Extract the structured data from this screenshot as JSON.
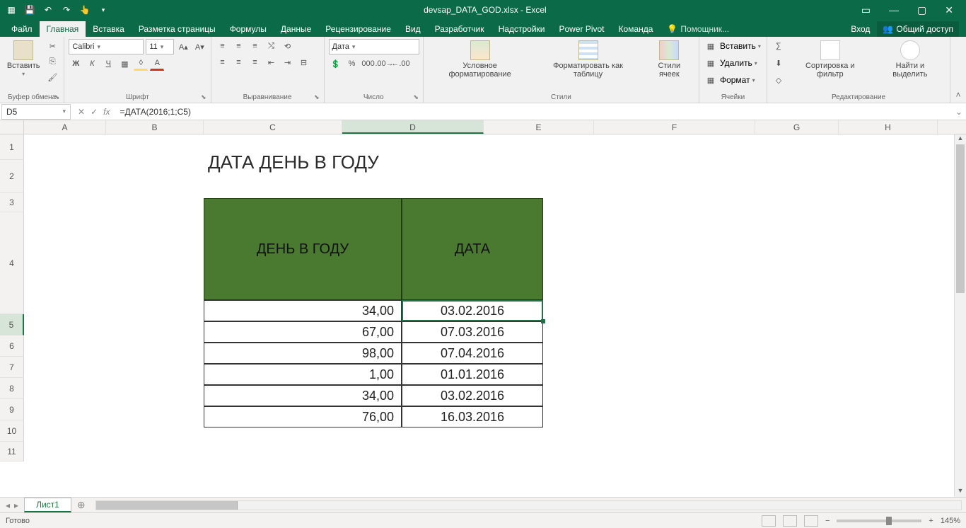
{
  "app": {
    "title": "devsap_DATA_GOD.xlsx - Excel"
  },
  "qat": {
    "save": "💾",
    "undo": "↶",
    "redo": "↷",
    "touch": "👆"
  },
  "wincontrols": {
    "opts": "▭",
    "min": "—",
    "max": "▢",
    "close": "✕"
  },
  "tabs": {
    "file": "Файл",
    "home": "Главная",
    "insert": "Вставка",
    "layout": "Разметка страницы",
    "formulas": "Формулы",
    "data": "Данные",
    "review": "Рецензирование",
    "view": "Вид",
    "developer": "Разработчик",
    "addins": "Надстройки",
    "powerpivot": "Power Pivot",
    "team": "Команда",
    "tellme": "Помощник...",
    "signin": "Вход",
    "share": "Общий доступ"
  },
  "ribbon": {
    "clipboard": {
      "paste": "Вставить",
      "label": "Буфер обмена"
    },
    "font": {
      "name": "Calibri",
      "size": "11",
      "bold": "Ж",
      "italic": "К",
      "underline": "Ч",
      "label": "Шрифт"
    },
    "alignment": {
      "wrap": "⟲",
      "merge": "⊟",
      "label": "Выравнивание"
    },
    "number": {
      "format": "Дата",
      "label": "Число",
      "percent": "%",
      "comma": "000",
      "sep": "‰"
    },
    "styles": {
      "cond": "Условное форматирование",
      "table": "Форматировать как таблицу",
      "cell": "Стили ячеек",
      "label": "Стили"
    },
    "cells": {
      "insert": "Вставить",
      "delete": "Удалить",
      "format": "Формат",
      "label": "Ячейки"
    },
    "editing": {
      "sum": "∑",
      "fill": "⬇",
      "clear": "◇",
      "sort": "Сортировка и фильтр",
      "find": "Найти и выделить",
      "label": "Редактирование"
    }
  },
  "namebox": "D5",
  "formula": "=ДАТА(2016;1;C5)",
  "columns": [
    "A",
    "B",
    "C",
    "D",
    "E",
    "F",
    "G",
    "H"
  ],
  "rownums": [
    "1",
    "2",
    "3",
    "4",
    "5",
    "6",
    "7",
    "8",
    "9",
    "10",
    "11"
  ],
  "sheet": {
    "title": "ДАТА ДЕНЬ В ГОДУ",
    "hdr1": "ДЕНЬ В ГОДУ",
    "hdr2": "ДАТА",
    "rows": [
      {
        "day": "34,00",
        "date": "03.02.2016"
      },
      {
        "day": "67,00",
        "date": "07.03.2016"
      },
      {
        "day": "98,00",
        "date": "07.04.2016"
      },
      {
        "day": "1,00",
        "date": "01.01.2016"
      },
      {
        "day": "34,00",
        "date": "03.02.2016"
      },
      {
        "day": "76,00",
        "date": "16.03.2016"
      }
    ]
  },
  "sheettab": "Лист1",
  "status": {
    "ready": "Готово",
    "zoom": "145%"
  }
}
